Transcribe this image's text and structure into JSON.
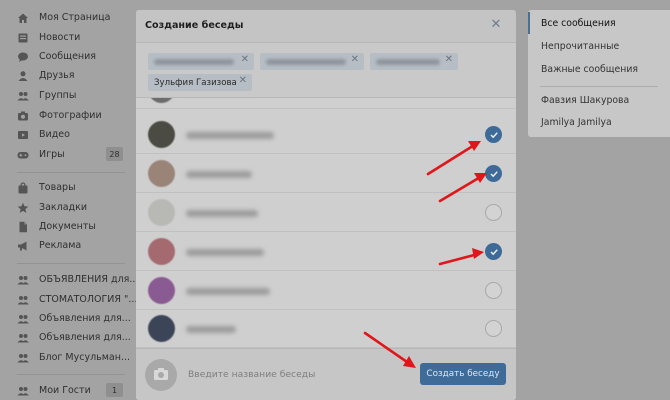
{
  "sidebar": {
    "items": [
      {
        "label": "Моя Страница",
        "icon": "home-icon"
      },
      {
        "label": "Новости",
        "icon": "news-icon"
      },
      {
        "label": "Сообщения",
        "icon": "messages-icon"
      },
      {
        "label": "Друзья",
        "icon": "friends-icon"
      },
      {
        "label": "Группы",
        "icon": "groups-icon"
      },
      {
        "label": "Фотографии",
        "icon": "camera-icon"
      },
      {
        "label": "Видео",
        "icon": "video-icon"
      },
      {
        "label": "Игры",
        "icon": "gamepad-icon",
        "count": "28"
      },
      {
        "label": "Товары",
        "icon": "bag-icon"
      },
      {
        "label": "Закладки",
        "icon": "star-icon"
      },
      {
        "label": "Документы",
        "icon": "document-icon"
      },
      {
        "label": "Реклама",
        "icon": "megaphone-icon"
      },
      {
        "label": "ОБЪЯВЛЕНИЯ для...",
        "icon": "group-icon"
      },
      {
        "label": "СТОМАТОЛОГИЯ \"...",
        "icon": "group-icon"
      },
      {
        "label": "Объявления для...",
        "icon": "group-icon"
      },
      {
        "label": "Объявления для...",
        "icon": "group-icon"
      },
      {
        "label": "Блог Мусульман...",
        "icon": "group-icon"
      },
      {
        "label": "Мои Гости",
        "icon": "group-icon",
        "count": "1"
      }
    ]
  },
  "right_panel": {
    "items": [
      {
        "label": "Все сообщения",
        "active": true
      },
      {
        "label": "Непрочитанные"
      },
      {
        "label": "Важные сообщения"
      },
      {
        "label": "Фавзия Шакурова"
      },
      {
        "label": "Jamilya Jamilya"
      }
    ]
  },
  "modal": {
    "title": "Создание беседы",
    "close_icon": "close-icon",
    "chips": [
      {
        "label": ""
      },
      {
        "label": ""
      },
      {
        "label": ""
      },
      {
        "label": "Зульфия Газизова"
      }
    ],
    "members": [
      {
        "checked": true,
        "avatar_color": "#6c6c6c"
      },
      {
        "checked": true,
        "avatar_color": "#4b4b44"
      },
      {
        "checked": true,
        "avatar_color": "#9a8478"
      },
      {
        "checked": false,
        "avatar_color": "#b8b8b4"
      },
      {
        "checked": true,
        "avatar_color": "#a56a70"
      },
      {
        "checked": false,
        "avatar_color": "#8a5a92"
      },
      {
        "checked": false,
        "avatar_color": "#3c4558"
      }
    ],
    "footer": {
      "name_placeholder": "Введите название беседы",
      "create_button": "Создать беседу"
    }
  },
  "colors": {
    "accent": "#3f6b99",
    "arrow": "#e0161b",
    "overlay": "#a3a3a3"
  }
}
